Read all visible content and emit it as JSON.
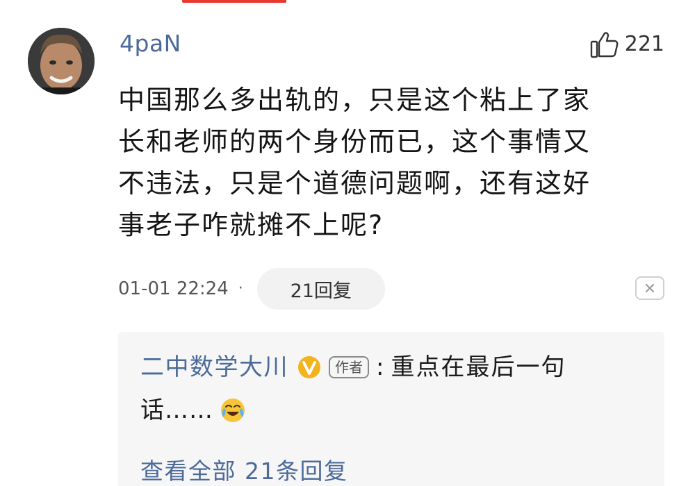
{
  "comment": {
    "username": "4paN",
    "like_count": "221",
    "text_lines": [
      "中国那么多出轨的，只是这个粘上了家",
      "长和老师的两个身份而已，这个事情又",
      "不违法，只是个道德问题啊，还有这好",
      "事老子咋就摊不上呢?"
    ],
    "time": "01-01 22:24",
    "separator": "·",
    "reply_count_label": "21回复"
  },
  "reply": {
    "author": "二中数学大川",
    "author_tag": "作者",
    "colon": ":",
    "text_line1": "重点在最后一句",
    "text_line2": "话……",
    "view_all_label": "查看全部 21条回复"
  },
  "icons": {
    "like": "thumbs-up-icon",
    "close": "close-icon",
    "verified": "verified-v-icon",
    "emoji": "crying-laughing-emoji-icon"
  },
  "colors": {
    "link_blue": "#4b6a99",
    "accent_red": "#e8382f",
    "reply_bg": "#f6f6f6",
    "pill_bg": "#f2f2f2",
    "verified_gold": "#f2b31c"
  }
}
